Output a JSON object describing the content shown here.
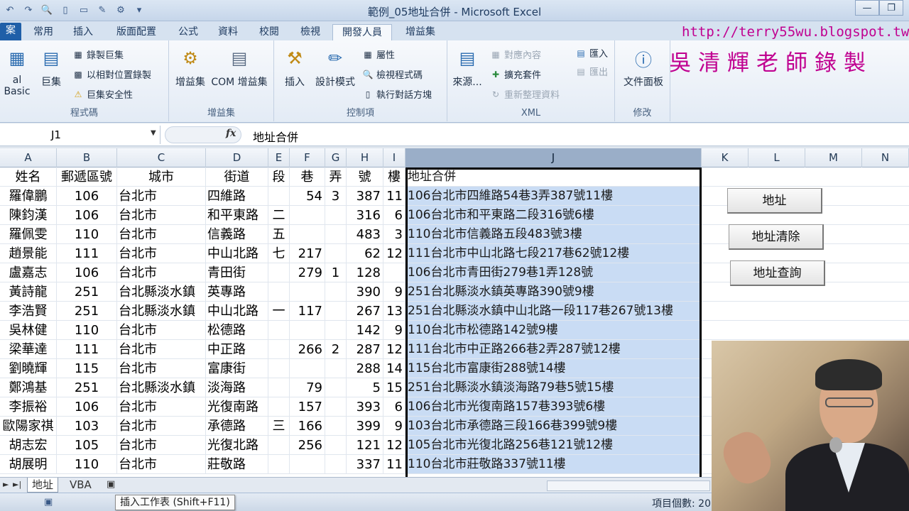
{
  "window": {
    "title": "範例_05地址合併 - Microsoft Excel",
    "minimize_icon": "—",
    "restore_icon": "❐"
  },
  "overlay": {
    "blog_url": "http://terry55wu.blogspot.tw",
    "signature": "吳清輝老師錄製"
  },
  "tabs": [
    "案",
    "常用",
    "插入",
    "版面配置",
    "公式",
    "資料",
    "校閱",
    "檢視",
    "開發人員",
    "增益集"
  ],
  "ribbon": {
    "code_group": {
      "label": "程式碼",
      "visual_basic": "al Basic",
      "macros": "巨集",
      "record_macro": "錄製巨集",
      "relative_ref": "以相對位置錄製",
      "macro_security": "巨集安全性"
    },
    "addins_group": {
      "label": "增益集",
      "addins": "增益集",
      "com_addins": "COM 增益集"
    },
    "controls_group": {
      "label": "控制項",
      "insert": "插入",
      "design_mode": "設計模式",
      "properties": "屬性",
      "view_code": "檢視程式碼",
      "run_dialog": "執行對話方塊"
    },
    "xml_group": {
      "label": "XML",
      "source": "來源...",
      "map_properties": "對應內容",
      "expansion_packs": "擴充套件",
      "refresh_data": "重新整理資料",
      "import": "匯入",
      "export": "匯出"
    },
    "modify_group": {
      "label": "修改",
      "document_panel": "文件面板"
    }
  },
  "formula_bar": {
    "name_box": "J1",
    "formula": "地址合併"
  },
  "columns": [
    "A",
    "B",
    "C",
    "D",
    "E",
    "F",
    "G",
    "H",
    "I",
    "J",
    "K",
    "L",
    "M",
    "N"
  ],
  "headers": [
    "姓名",
    "郵遞區號",
    "城市",
    "街道",
    "段",
    "巷",
    "弄",
    "號",
    "樓",
    "地址合併"
  ],
  "rows": [
    [
      "羅偉鵬",
      "106",
      "台北市",
      "四維路",
      "",
      "54",
      "3",
      "387",
      "11",
      "106台北市四維路54巷3弄387號11樓"
    ],
    [
      "陳鈞漢",
      "106",
      "台北市",
      "和平東路",
      "二",
      "",
      "",
      "316",
      "6",
      "106台北市和平東路二段316號6樓"
    ],
    [
      "羅佩雯",
      "110",
      "台北市",
      "信義路",
      "五",
      "",
      "",
      "483",
      "3",
      "110台北市信義路五段483號3樓"
    ],
    [
      "趙景能",
      "111",
      "台北市",
      "中山北路",
      "七",
      "217",
      "",
      "62",
      "12",
      "111台北市中山北路七段217巷62號12樓"
    ],
    [
      "盧嘉志",
      "106",
      "台北市",
      "青田街",
      "",
      "279",
      "1",
      "128",
      "",
      "106台北市青田街279巷1弄128號"
    ],
    [
      "黃詩龍",
      "251",
      "台北縣淡水鎮",
      "英專路",
      "",
      "",
      "",
      "390",
      "9",
      "251台北縣淡水鎮英專路390號9樓"
    ],
    [
      "李浩賢",
      "251",
      "台北縣淡水鎮",
      "中山北路",
      "一",
      "117",
      "",
      "267",
      "13",
      "251台北縣淡水鎮中山北路一段117巷267號13樓"
    ],
    [
      "吳林健",
      "110",
      "台北市",
      "松德路",
      "",
      "",
      "",
      "142",
      "9",
      "110台北市松德路142號9樓"
    ],
    [
      "梁華達",
      "111",
      "台北市",
      "中正路",
      "",
      "266",
      "2",
      "287",
      "12",
      "111台北市中正路266巷2弄287號12樓"
    ],
    [
      "劉曉輝",
      "115",
      "台北市",
      "富康街",
      "",
      "",
      "",
      "288",
      "14",
      "115台北市富康街288號14樓"
    ],
    [
      "鄭鴻基",
      "251",
      "台北縣淡水鎮",
      "淡海路",
      "",
      "79",
      "",
      "5",
      "15",
      "251台北縣淡水鎮淡海路79巷5號15樓"
    ],
    [
      "李振裕",
      "106",
      "台北市",
      "光復南路",
      "",
      "157",
      "",
      "393",
      "6",
      "106台北市光復南路157巷393號6樓"
    ],
    [
      "歐陽家祺",
      "103",
      "台北市",
      "承德路",
      "三",
      "166",
      "",
      "399",
      "9",
      "103台北市承德路三段166巷399號9樓"
    ],
    [
      "胡志宏",
      "105",
      "台北市",
      "光復北路",
      "",
      "256",
      "",
      "121",
      "12",
      "105台北市光復北路256巷121號12樓"
    ],
    [
      "胡展明",
      "110",
      "台北市",
      "莊敬路",
      "",
      "",
      "",
      "337",
      "11",
      "110台北市莊敬路337號11樓"
    ]
  ],
  "buttons": {
    "address": "地址",
    "address_clear": "地址清除",
    "address_query": "地址查詢"
  },
  "sheets": [
    "地址",
    "VBA"
  ],
  "tooltip": "插入工作表 (Shift+F11)",
  "status": {
    "count": "項目個數: 20"
  }
}
